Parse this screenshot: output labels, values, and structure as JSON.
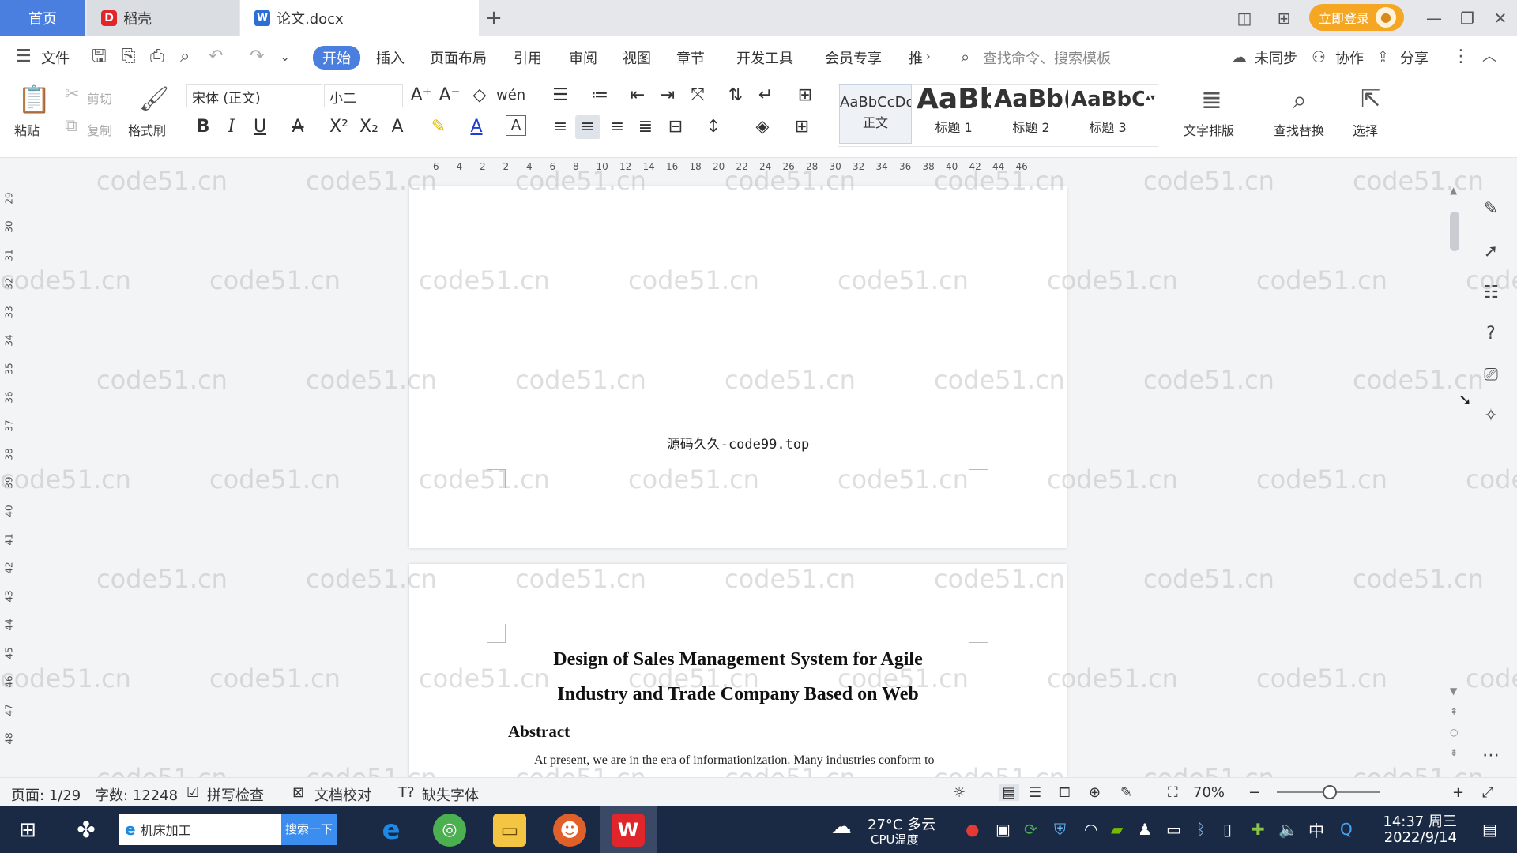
{
  "titlebar": {
    "tabs": [
      {
        "label": "首页"
      },
      {
        "label": "稻壳"
      },
      {
        "label": "论文.docx"
      }
    ],
    "login_label": "立即登录"
  },
  "menu": {
    "file": "文件",
    "items": [
      "开始",
      "插入",
      "页面布局",
      "引用",
      "审阅",
      "视图",
      "章节",
      "开发工具",
      "会员专享",
      "推"
    ],
    "search_placeholder": "查找命令、搜索模板",
    "sync": "未同步",
    "collab": "协作",
    "share": "分享"
  },
  "ribbon": {
    "paste": "粘贴",
    "cut": "剪切",
    "copy": "复制",
    "format_painter": "格式刷",
    "font_name": "宋体 (正文)",
    "font_size": "小二",
    "styles": [
      {
        "sample": "AaBbCcDd",
        "name": "正文"
      },
      {
        "sample": "AaBb",
        "name": "标题 1"
      },
      {
        "sample": "AaBb(",
        "name": "标题 2"
      },
      {
        "sample": "AaBbC",
        "name": "标题 3"
      }
    ],
    "text_layout": "文字排版",
    "find_replace": "查找替换",
    "select": "选择"
  },
  "ruler": {
    "numbers": [
      "6",
      "4",
      "2",
      "2",
      "4",
      "6",
      "8",
      "10",
      "12",
      "14",
      "16",
      "18",
      "20",
      "22",
      "24",
      "26",
      "28",
      "30",
      "32",
      "34",
      "36",
      "38",
      "40",
      "42",
      "44",
      "46"
    ],
    "vertical_numbers": [
      "29",
      "30",
      "31",
      "32",
      "33",
      "34",
      "35",
      "36",
      "37",
      "38",
      "39",
      "40",
      "41",
      "42",
      "43",
      "44",
      "45",
      "46",
      "47",
      "48"
    ]
  },
  "document": {
    "page1_footer": "源码久久-code99.top",
    "title_line1": "Design of Sales Management System for Agile",
    "title_line2": "Industry and Trade Company Based on Web",
    "abstract_heading": "Abstract",
    "abstract_text": "At present, we are in the era of informationization. Many industries conform to"
  },
  "watermark": "code51.cn",
  "statusbar": {
    "page": "页面: 1/29",
    "words": "字数: 12248",
    "spell_check": "拼写检查",
    "doc_check": "文档校对",
    "missing_font": "缺失字体",
    "zoom": "70%"
  },
  "taskbar": {
    "search_text": "机床加工",
    "search_button": "搜索一下",
    "weather": "27°C 多云",
    "cpu": "CPU温度",
    "ime": "中",
    "time": "14:37 周三",
    "date": "2022/9/14"
  }
}
